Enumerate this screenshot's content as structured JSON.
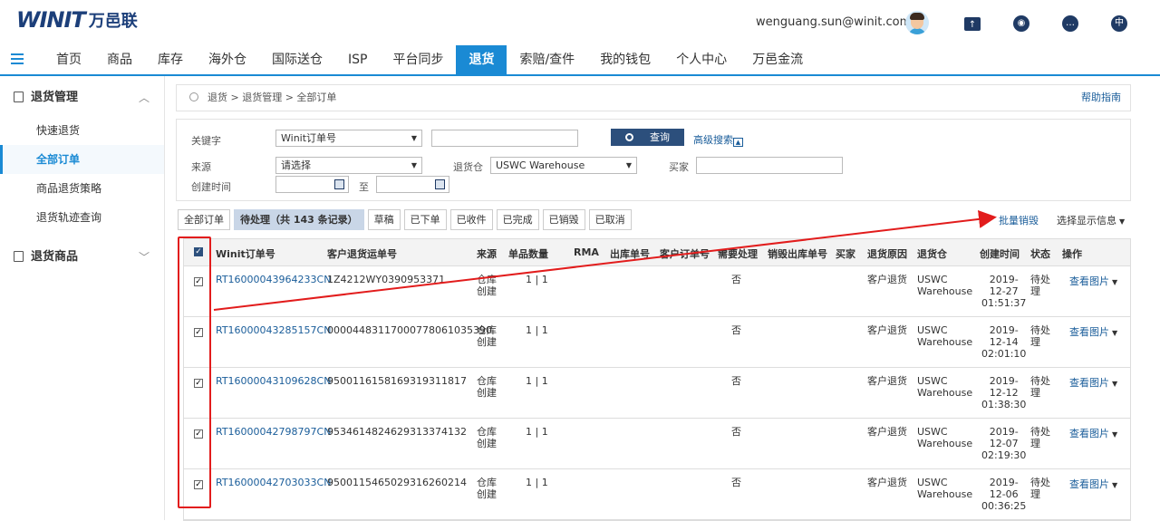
{
  "header": {
    "logo_mark": "WINIT",
    "logo_cn": "万邑联",
    "user_email": "wenguang.sun@winit.com.cn",
    "lang_label": "中",
    "icons": [
      "upload-folder-icon",
      "support-icon",
      "message-icon",
      "language-icon"
    ]
  },
  "nav": {
    "items": [
      "首页",
      "商品",
      "库存",
      "海外仓",
      "国际送仓",
      "ISP",
      "平台同步",
      "退货",
      "索赔/查件",
      "我的钱包",
      "个人中心",
      "万邑金流"
    ],
    "active": "退货"
  },
  "sidebar": {
    "group1": "退货管理",
    "items": [
      "快速退货",
      "全部订单",
      "商品退货策略",
      "退货轨迹查询"
    ],
    "active_item": "全部订单",
    "group2": "退货商品"
  },
  "breadcrumb": {
    "path": "退货 > 退货管理 > 全部订单",
    "help": "帮助指南"
  },
  "search": {
    "keyword_label": "关键字",
    "keyword_type": "Winit订单号",
    "keyword_value": "",
    "query_label": "查询",
    "advanced_label": "高级搜索",
    "source_label": "来源",
    "source_value": "请选择",
    "warehouse_label": "退货仓",
    "warehouse_value": "USWC Warehouse",
    "buyer_label": "买家",
    "buyer_value": "",
    "created_label": "创建时间",
    "to_label": "至"
  },
  "tabs": [
    "全部订单",
    "待处理（共 143 条记录）",
    "草稿",
    "已下单",
    "已收件",
    "已完成",
    "已销毁",
    "已取消"
  ],
  "actions": {
    "batch_destroy": "批量销毁",
    "select_display": "选择显示信息"
  },
  "table": {
    "headers": [
      "Winit订单号",
      "客户退货运单号",
      "来源",
      "单品数量",
      "RMA",
      "出库单号",
      "客户订单号",
      "需要处理",
      "销毁出库单号",
      "买家",
      "退货原因",
      "退货仓",
      "创建时间",
      "状态",
      "操作"
    ],
    "rows": [
      {
        "order": "RT16000043964233CN",
        "waybill": "1Z4212WY0390953371",
        "source": [
          "仓库",
          "创建"
        ],
        "qty": "1 | 1",
        "handle": "否",
        "reason": "客户退货",
        "warehouse": [
          "USWC",
          "Warehouse"
        ],
        "created": [
          "2019-",
          "12-27",
          "01:51:37"
        ],
        "status": [
          "待处",
          "理"
        ],
        "action": "查看图片"
      },
      {
        "order": "RT16000043285157CN",
        "waybill": "000044831170007780610353​90",
        "source": [
          "仓库",
          "创建"
        ],
        "qty": "1 | 1",
        "handle": "否",
        "reason": "客户退货",
        "warehouse": [
          "USWC",
          "Warehouse"
        ],
        "created": [
          "2019-",
          "12-14",
          "02:01:10"
        ],
        "status": [
          "待处",
          "理"
        ],
        "action": "查看图片"
      },
      {
        "order": "RT16000043109628CN",
        "waybill": "9500116158169319311817",
        "source": [
          "仓库",
          "创建"
        ],
        "qty": "1 | 1",
        "handle": "否",
        "reason": "客户退货",
        "warehouse": [
          "USWC",
          "Warehouse"
        ],
        "created": [
          "2019-",
          "12-12",
          "01:38:30"
        ],
        "status": [
          "待处",
          "理"
        ],
        "action": "查看图片"
      },
      {
        "order": "RT16000042798797CN",
        "waybill": "9534614824629313374132",
        "source": [
          "仓库",
          "创建"
        ],
        "qty": "1 | 1",
        "handle": "否",
        "reason": "客户退货",
        "warehouse": [
          "USWC",
          "Warehouse"
        ],
        "created": [
          "2019-",
          "12-07",
          "02:19:30"
        ],
        "status": [
          "待处",
          "理"
        ],
        "action": "查看图片"
      },
      {
        "order": "RT16000042703033CN",
        "waybill": "9500115465029316260214",
        "source": [
          "仓库",
          "创建"
        ],
        "qty": "1 | 1",
        "handle": "否",
        "reason": "客户退货",
        "warehouse": [
          "USWC",
          "Warehouse"
        ],
        "created": [
          "2019-",
          "12-06",
          "00:36:25"
        ],
        "status": [
          "待处",
          "理"
        ],
        "action": "查看图片"
      }
    ]
  },
  "colors": {
    "primary": "#1a8ad4",
    "dark_button": "#2c4f7c",
    "link": "#1a5d9a",
    "annotation": "#e21c1c"
  }
}
